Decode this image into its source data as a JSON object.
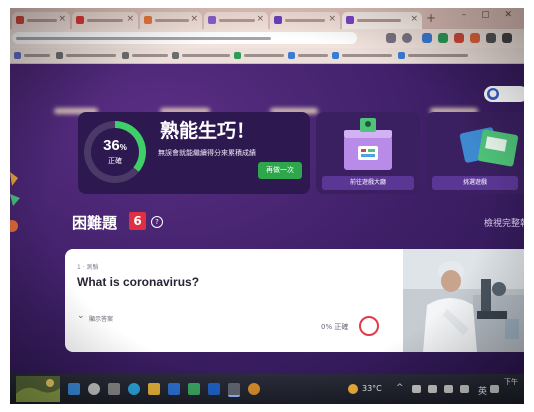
{
  "summary": {
    "percent": "36",
    "percent_sign": "%",
    "percent_label": "正確",
    "heading": "熟能生巧！",
    "subtitle": "無誤會就能繼續得分來累積成績",
    "retry_label": "再做一次"
  },
  "cards": [
    {
      "label": "前往遊戲大廳"
    },
    {
      "label": "挑選遊戲"
    }
  ],
  "difficult": {
    "title": "困難題",
    "count": "6",
    "report_link": "檢視完整報告"
  },
  "question": {
    "type_label": "1 · 測驗",
    "text": "What is coronavirus?",
    "show_answer_label": "顯示答案",
    "accuracy_label": "0% 正確"
  },
  "taskbar": {
    "weather": "33°C",
    "ime": "英",
    "clock": "下午"
  },
  "colors": {
    "page_bg": "#3d1f66",
    "accent_green": "#3fcf68",
    "badge_red": "#e02f40"
  },
  "icons": [
    "help-icon",
    "chevron-down-icon",
    "wrong-circle-icon",
    "user-icon",
    "windows-icon",
    "search-icon"
  ]
}
